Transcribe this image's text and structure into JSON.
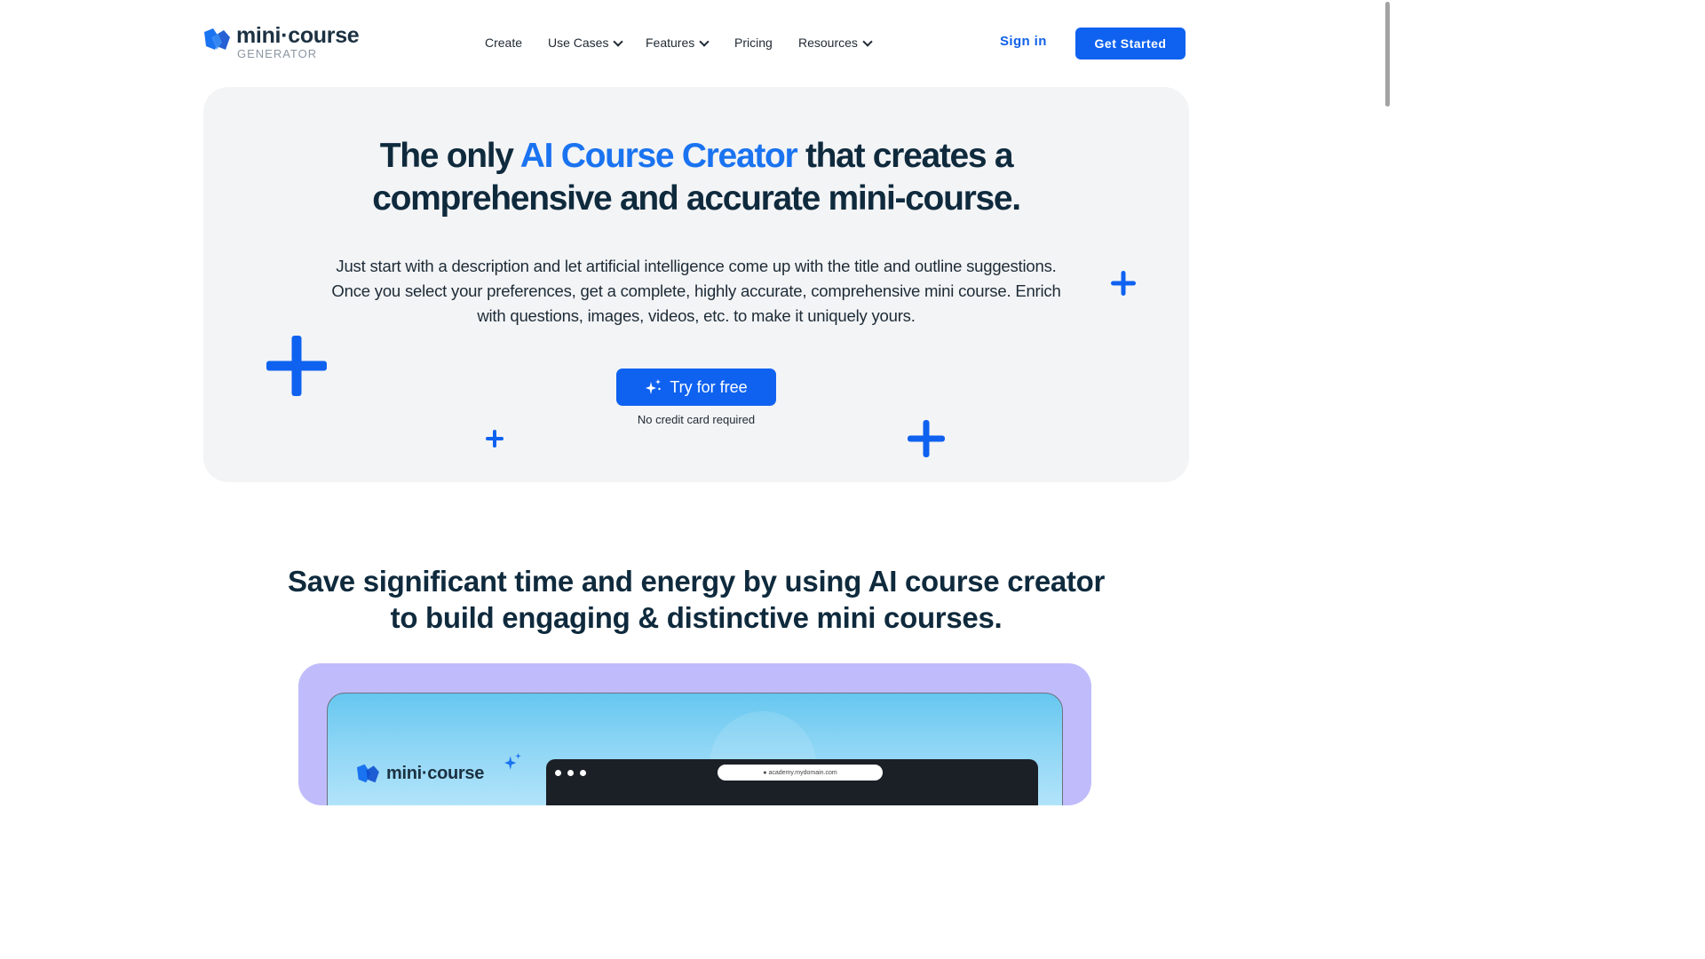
{
  "header": {
    "logo_name": "mini·course",
    "logo_sub": "GENERATOR",
    "nav": {
      "create": "Create",
      "use_cases": "Use Cases",
      "features": "Features",
      "pricing": "Pricing",
      "resources": "Resources"
    },
    "sign_in": "Sign in",
    "get_started": "Get Started"
  },
  "hero": {
    "title_part1": "The only ",
    "title_accent": "AI Course Creator",
    "title_part2": " that creates a",
    "title_line2": "comprehensive and accurate mini-course.",
    "description": "Just start with a description and let artificial intelligence come up with the title and outline suggestions. Once you select your preferences, get a complete, highly accurate, comprehensive mini course. Enrich with questions, images, videos, etc. to make it uniquely yours.",
    "cta_label": "Try for free",
    "cta_note": "No credit card required"
  },
  "section": {
    "title_line1": "Save significant time and energy by using AI course creator",
    "title_line2": "to build engaging & distinctive mini courses."
  },
  "demo": {
    "logo_name": "mini·course",
    "url": "● academy.mydomain.com"
  },
  "colors": {
    "brand_blue": "#0f62f0",
    "accent_blue": "#1a73f0",
    "heading": "#0f2a3d",
    "hero_bg": "#f3f4f6",
    "demo_frame": "#c0bcfc"
  },
  "icons": [
    "logo-mark-icon",
    "chevron-down-icon",
    "sparkle-icon",
    "plus-icon"
  ]
}
